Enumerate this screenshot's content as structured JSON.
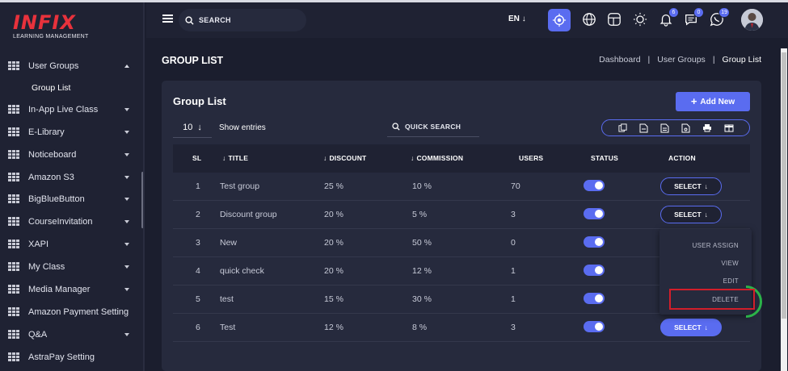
{
  "brand": {
    "logo": "INFIX",
    "tagline": "LEARNING MANAGEMENT"
  },
  "sidebar": {
    "items": [
      {
        "label": "User Groups",
        "open": true
      },
      {
        "label": "In-App Live Class"
      },
      {
        "label": "E-Library"
      },
      {
        "label": "Noticeboard"
      },
      {
        "label": "Amazon S3"
      },
      {
        "label": "BigBlueButton"
      },
      {
        "label": "CourseInvitation"
      },
      {
        "label": "XAPI"
      },
      {
        "label": "My Class"
      },
      {
        "label": "Media Manager"
      },
      {
        "label": "Amazon Payment Setting"
      },
      {
        "label": "Q&A"
      },
      {
        "label": "AstraPay Setting"
      }
    ],
    "sub_item": "Group List"
  },
  "header": {
    "search_placeholder": "SEARCH",
    "language": "EN",
    "notification_count": "6",
    "message_count": "0",
    "chat_count": "19"
  },
  "page": {
    "title": "GROUP LIST",
    "breadcrumb": [
      "Dashboard",
      "User Groups",
      "Group List"
    ],
    "breadcrumb_sep": "|"
  },
  "card": {
    "title": "Group List",
    "add_button": "Add New",
    "entries_value": "10",
    "entries_label": "Show entries",
    "quick_search": "QUICK SEARCH"
  },
  "table": {
    "headers": {
      "sl": "SL",
      "title": "TITLE",
      "discount": "DISCOUNT",
      "commission": "COMMISSION",
      "users": "USERS",
      "status": "STATUS",
      "action": "ACTION"
    },
    "rows": [
      {
        "sl": "1",
        "title": "Test group",
        "discount": "25 %",
        "commission": "10 %",
        "users": "70",
        "status": true
      },
      {
        "sl": "2",
        "title": "Discount group",
        "discount": "20 %",
        "commission": "5 %",
        "users": "3",
        "status": true
      },
      {
        "sl": "3",
        "title": "New",
        "discount": "20 %",
        "commission": "50 %",
        "users": "0",
        "status": true
      },
      {
        "sl": "4",
        "title": "quick check",
        "discount": "20 %",
        "commission": "12 %",
        "users": "1",
        "status": true
      },
      {
        "sl": "5",
        "title": "test",
        "discount": "15 %",
        "commission": "30 %",
        "users": "1",
        "status": true
      },
      {
        "sl": "6",
        "title": "Test",
        "discount": "12 %",
        "commission": "8 %",
        "users": "3",
        "status": true
      }
    ],
    "select_label": "SELECT"
  },
  "action_menu": [
    "USER ASSIGN",
    "VIEW",
    "EDIT",
    "DELETE"
  ],
  "colors": {
    "accent": "#5a6cf0",
    "brand": "#e8323c",
    "highlight": "#d21e2a"
  }
}
